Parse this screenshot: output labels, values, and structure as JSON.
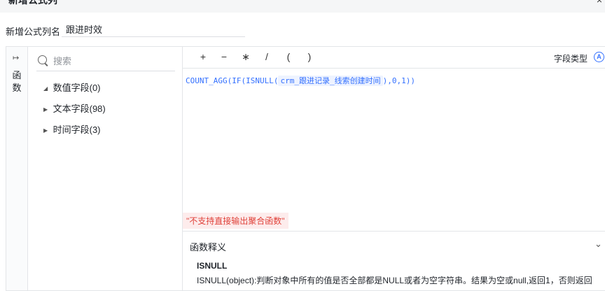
{
  "dialog": {
    "title": "新增公式列",
    "close_glyph": "×"
  },
  "column_name": {
    "label": "新增公式列名",
    "value": "跟进时效"
  },
  "rail": {
    "icon": "collapse-arrow-icon",
    "label": "函数"
  },
  "fields": {
    "search_placeholder": "搜索",
    "groups": [
      {
        "label": "数值字段(0)",
        "expanded": true
      },
      {
        "label": "文本字段(98)",
        "expanded": false
      },
      {
        "label": "时间字段(3)",
        "expanded": false
      }
    ]
  },
  "toolbar": {
    "operators": [
      "+",
      "−",
      "∗",
      "/",
      "(",
      ")"
    ],
    "field_type_label": "字段类型",
    "field_type_icon": "A"
  },
  "formula": {
    "prefix": "COUNT_AGG(IF(ISNULL(",
    "field": "crm_跟进记录_线索创建时间",
    "suffix": "),0,1))"
  },
  "error": "\"不支持直接输出聚合函数\"",
  "help": {
    "title": "函数释义",
    "function_name": "ISNULL",
    "description": "ISNULL(object):判断对象中所有的值是否全部都是NULL或者为空字符串。结果为空或null,返回1，否则返回"
  },
  "colors": {
    "accent": "#3370ff",
    "error": "#e0423a",
    "error_bg": "#fdecec"
  }
}
